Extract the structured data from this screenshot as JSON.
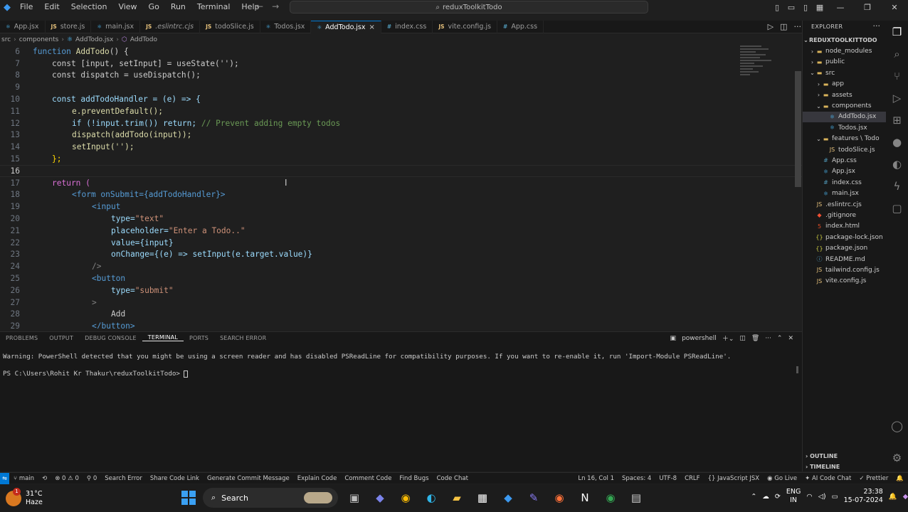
{
  "menu": [
    "File",
    "Edit",
    "Selection",
    "View",
    "Go",
    "Run",
    "Terminal",
    "Help"
  ],
  "search_placeholder": "reduxToolkitTodo",
  "tabs": [
    {
      "label": "App.jsx",
      "type": "rx"
    },
    {
      "label": "store.js",
      "type": "js"
    },
    {
      "label": "main.jsx",
      "type": "rx"
    },
    {
      "label": ".eslintrc.cjs",
      "type": "js"
    },
    {
      "label": "todoSlice.js",
      "type": "js"
    },
    {
      "label": "Todos.jsx",
      "type": "rx"
    },
    {
      "label": "AddTodo.jsx",
      "type": "rx",
      "active": true
    },
    {
      "label": "index.css",
      "type": "css"
    },
    {
      "label": "vite.config.js",
      "type": "js"
    },
    {
      "label": "App.css",
      "type": "css"
    }
  ],
  "breadcrumb": [
    "src",
    "components",
    "AddTodo.jsx",
    "AddTodo"
  ],
  "code_lines": [
    {
      "n": "6"
    },
    {
      "n": "7"
    },
    {
      "n": "8"
    },
    {
      "n": "9"
    },
    {
      "n": "10"
    },
    {
      "n": "11"
    },
    {
      "n": "12"
    },
    {
      "n": "13"
    },
    {
      "n": "14"
    },
    {
      "n": "15"
    },
    {
      "n": "16"
    },
    {
      "n": "17"
    },
    {
      "n": "18"
    },
    {
      "n": "19"
    },
    {
      "n": "20"
    },
    {
      "n": "21"
    },
    {
      "n": "22"
    },
    {
      "n": "23"
    },
    {
      "n": "24"
    },
    {
      "n": "25"
    },
    {
      "n": "26"
    },
    {
      "n": "27"
    },
    {
      "n": "28"
    },
    {
      "n": "29"
    }
  ],
  "code": {
    "l6_kw": "function",
    "l6_fn": "AddTodo",
    "l6_rest": "() {",
    "l7": "const [input, setInput] = useState('');",
    "l8": "const dispatch = useDispatch();",
    "l10": "const addTodoHandler = (e) => {",
    "l11": "e.preventDefault();",
    "l12_code": "if (!input.trim()) return;",
    "l12_cm": "// Prevent adding empty todos",
    "l13": "dispatch(addTodo(input));",
    "l14": "setInput('');",
    "l15": "};",
    "l17": "return (",
    "l18": "<form onSubmit={addTodoHandler}>",
    "l19": "<input",
    "l20_a": "type=",
    "l20_v": "\"text\"",
    "l21_a": "placeholder=",
    "l21_v": "\"Enter a Todo..\"",
    "l22": "value={input}",
    "l23": "onChange={(e) => setInput(e.target.value)}",
    "l24": "/>",
    "l25": "<button",
    "l26_a": "type=",
    "l26_v": "\"submit\"",
    "l27": ">",
    "l28": "Add",
    "l29": "</button>"
  },
  "panel_tabs": [
    "PROBLEMS",
    "OUTPUT",
    "DEBUG CONSOLE",
    "TERMINAL",
    "PORTS",
    "SEARCH ERROR"
  ],
  "panel_active": "TERMINAL",
  "terminal_shell": "powershell",
  "terminal_warning": "Warning: PowerShell detected that you might be using a screen reader and has disabled PSReadLine for compatibility purposes. If you want to re-enable it, run 'Import-Module PSReadLine'.",
  "terminal_prompt": "PS C:\\Users\\Rohit Kr Thakur\\reduxToolkitTodo> ",
  "explorer": {
    "title": "EXPLORER",
    "root": "REDUXTOOLKITTODO",
    "items": [
      {
        "label": "node_modules",
        "kind": "folder",
        "depth": 1,
        "arrow": "›"
      },
      {
        "label": "public",
        "kind": "folder",
        "depth": 1,
        "arrow": "›"
      },
      {
        "label": "src",
        "kind": "folder",
        "depth": 1,
        "arrow": "⌄"
      },
      {
        "label": "app",
        "kind": "folder",
        "depth": 2,
        "arrow": "›"
      },
      {
        "label": "assets",
        "kind": "folder",
        "depth": 2,
        "arrow": "›"
      },
      {
        "label": "components",
        "kind": "folder",
        "depth": 2,
        "arrow": "⌄"
      },
      {
        "label": "AddTodo.jsx",
        "kind": "rx",
        "depth": 3,
        "sel": true
      },
      {
        "label": "Todos.jsx",
        "kind": "rx",
        "depth": 3
      },
      {
        "label": "features \\ Todo",
        "kind": "folder",
        "depth": 2,
        "arrow": "⌄"
      },
      {
        "label": "todoSlice.js",
        "kind": "js",
        "depth": 3
      },
      {
        "label": "App.css",
        "kind": "css",
        "depth": 2
      },
      {
        "label": "App.jsx",
        "kind": "rx",
        "depth": 2
      },
      {
        "label": "index.css",
        "kind": "css",
        "depth": 2
      },
      {
        "label": "main.jsx",
        "kind": "rx",
        "depth": 2
      },
      {
        "label": ".eslintrc.cjs",
        "kind": "js",
        "depth": 1
      },
      {
        "label": ".gitignore",
        "kind": "git",
        "depth": 1
      },
      {
        "label": "index.html",
        "kind": "html",
        "depth": 1
      },
      {
        "label": "package-lock.json",
        "kind": "json",
        "depth": 1
      },
      {
        "label": "package.json",
        "kind": "json",
        "depth": 1
      },
      {
        "label": "README.md",
        "kind": "md",
        "depth": 1
      },
      {
        "label": "tailwind.config.js",
        "kind": "js",
        "depth": 1
      },
      {
        "label": "vite.config.js",
        "kind": "js",
        "depth": 1
      }
    ],
    "outline": "OUTLINE",
    "timeline": "TIMELINE"
  },
  "status": {
    "branch": "main",
    "errors": "0",
    "warnings": "0",
    "ports": "0",
    "left_items": [
      "Search Error",
      "Share Code Link",
      "Generate Commit Message",
      "Explain Code",
      "Comment Code",
      "Find Bugs",
      "Code Chat"
    ],
    "position": "Ln 16, Col 1",
    "spaces": "Spaces: 4",
    "encoding": "UTF-8",
    "eol": "CRLF",
    "language": "JavaScript JSX",
    "golive": "Go Live",
    "aichat": "AI Code Chat",
    "prettier": "Prettier"
  },
  "taskbar": {
    "temp": "31°C",
    "weather": "Haze",
    "weather_badge": "1",
    "search": "Search",
    "lang_top": "ENG",
    "lang_bottom": "IN",
    "time": "23:38",
    "date": "15-07-2024"
  },
  "colors": {
    "accent": "#0078d4",
    "bg": "#1f1f1f",
    "panel": "#181818"
  }
}
